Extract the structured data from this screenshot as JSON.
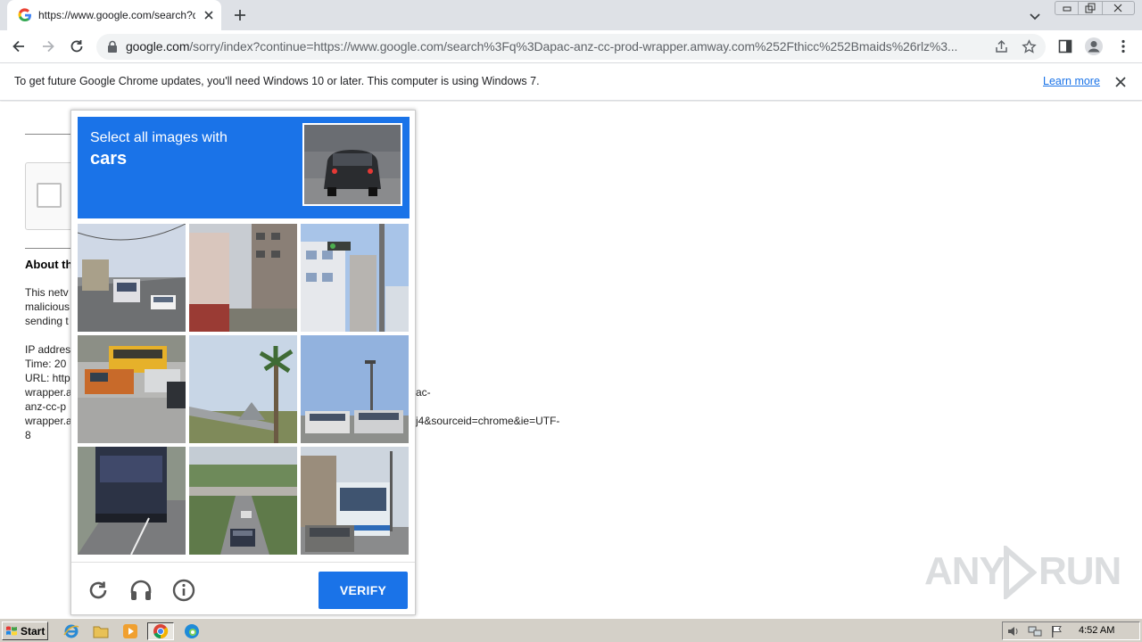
{
  "browser": {
    "tab": {
      "title": "https://www.google.com/search?q="
    },
    "address": {
      "host": "google.com",
      "rest": "/sorry/index?continue=https://www.google.com/search%3Fq%3Dapac-anz-cc-prod-wrapper.amway.com%252Fthicc%252Bmaids%26rlz%3..."
    }
  },
  "infobar": {
    "message": "To get future Google Chrome updates, you'll need Windows 10 or later. This computer is using Windows 7.",
    "link": "Learn more"
  },
  "page": {
    "about_heading": "About th",
    "para1": [
      "This netv",
      "malicious",
      "sending t"
    ],
    "para2": [
      "IP addres",
      "Time: 20",
      "URL: http",
      "wrapper.a",
      "anz-cc-p",
      "wrapper.a",
      "8"
    ],
    "right_fragments": [
      "ac-",
      "j4&sourceid=chrome&ie=UTF-"
    ]
  },
  "captcha": {
    "instruction": "Select all images with",
    "target": "cars",
    "verify_label": "VERIFY"
  },
  "taskbar": {
    "start_label": "Start",
    "clock": "4:52 AM"
  },
  "watermark": {
    "left": "ANY",
    "right": "RUN"
  },
  "colors": {
    "accent": "#1a73e8",
    "tabstrip": "#dee1e6",
    "taskbar": "#d4d0c8"
  }
}
